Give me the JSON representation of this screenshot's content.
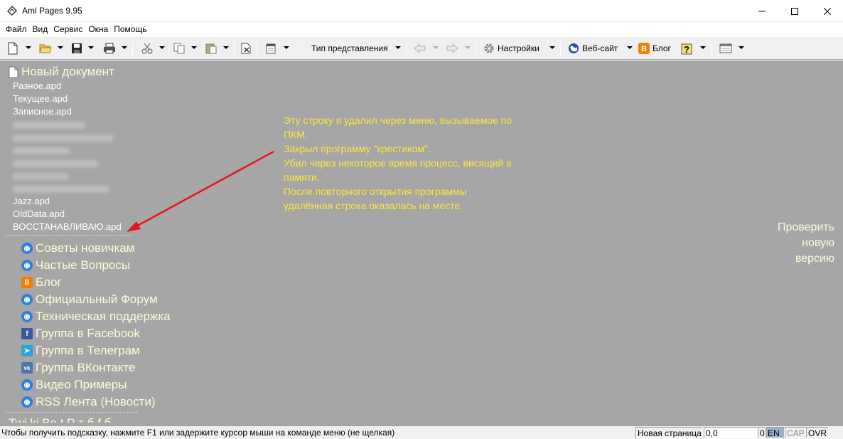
{
  "window": {
    "title": "Aml Pages 9.95",
    "min_glyph": "—",
    "max_glyph": "☐",
    "close_glyph": "✕"
  },
  "menu": [
    "Файл",
    "Вид",
    "Сервис",
    "Окна",
    "Помощь"
  ],
  "toolbar": {
    "view_type_label": "Тип представления",
    "settings_label": "Настройки",
    "website_label": "Веб-сайт",
    "blog_label": "Блог"
  },
  "document": {
    "title": "Новый документ"
  },
  "recent_files": {
    "visible_top": [
      "Разное.apd",
      "Текущее.apd",
      "Записное.apd"
    ],
    "visible_bottom": [
      "Jazz.apd",
      "OldData.apd",
      "ВОССТАНАВЛИВАЮ.apd"
    ]
  },
  "links": [
    {
      "label": "Советы новичкам",
      "icon": "globe-icon",
      "color": "#2e7de1"
    },
    {
      "label": "Частые Вопросы",
      "icon": "globe-icon",
      "color": "#2e7de1"
    },
    {
      "label": "Блог",
      "icon": "blogger-icon",
      "color": "#f57d00"
    },
    {
      "label": "Официальный Форум",
      "icon": "globe-icon",
      "color": "#2e7de1"
    },
    {
      "label": "Техническая поддержка",
      "icon": "globe-icon",
      "color": "#2e7de1"
    },
    {
      "label": "Группа в Facebook",
      "icon": "facebook-icon",
      "color": "#3b5998"
    },
    {
      "label": "Группа в Телеграм",
      "icon": "telegram-icon",
      "color": "#2aa3df"
    },
    {
      "label": "Группа ВКонтакте",
      "icon": "vk-icon",
      "color": "#4a76a8"
    },
    {
      "label": "Видео Примеры",
      "icon": "globe-icon",
      "color": "#2e7de1"
    },
    {
      "label": "RSS Лента (Новости)",
      "icon": "globe-icon",
      "color": "#2e7de1"
    }
  ],
  "annotation": {
    "lines": [
      "Эту строку я удалил через меню, вызываемое по",
      "ПКМ.",
      "Закрыл программу \"крестиком\".",
      "Убил через некоторое время процесс, висящий в",
      "памяти.",
      "После повторного открытия программы",
      "удалённая строка оказалась на месте."
    ],
    "color": "#ffe63d",
    "arrow_color": "#e8141b"
  },
  "check_version": {
    "line1": "Проверить",
    "line2": "новую",
    "line3": "версию"
  },
  "cut_off_text": "Twі ki  Bo t  Р           т            б   f    б",
  "statusbar": {
    "hint": "Чтобы получить подсказку, нажмите F1 или задержите курсор мыши на команде меню (не щелкая)",
    "page_label": "Новая страница",
    "position": "0,0",
    "count": "0",
    "lang": "EN",
    "cap": "CAP",
    "ovr": "OVR"
  },
  "colors": {
    "content_bg": "#a6a6a6",
    "link_text": "#fffbd7",
    "recent_text": "#ffffff"
  }
}
